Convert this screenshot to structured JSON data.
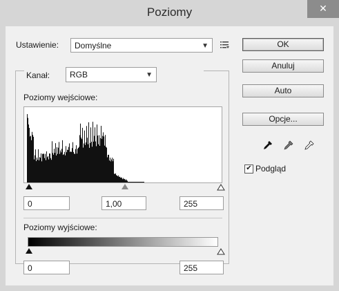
{
  "window": {
    "title": "Poziomy",
    "close_glyph": "✕"
  },
  "preset": {
    "label": "Ustawienie:",
    "value": "Domyślne",
    "menu_icon": "list-menu-icon"
  },
  "buttons": {
    "ok": "OK",
    "cancel": "Anuluj",
    "auto": "Auto",
    "options": "Opcje..."
  },
  "channel": {
    "label": "Kanał:",
    "value": "RGB"
  },
  "input_levels": {
    "label": "Poziomy wejściowe:",
    "black": "0",
    "gamma": "1,00",
    "white": "255"
  },
  "output_levels": {
    "label": "Poziomy wyjściowe:",
    "black": "0",
    "white": "255"
  },
  "eyedroppers": [
    "black-eyedropper-icon",
    "gray-eyedropper-icon",
    "white-eyedropper-icon"
  ],
  "preview": {
    "label": "Podgląd",
    "checked": true
  }
}
